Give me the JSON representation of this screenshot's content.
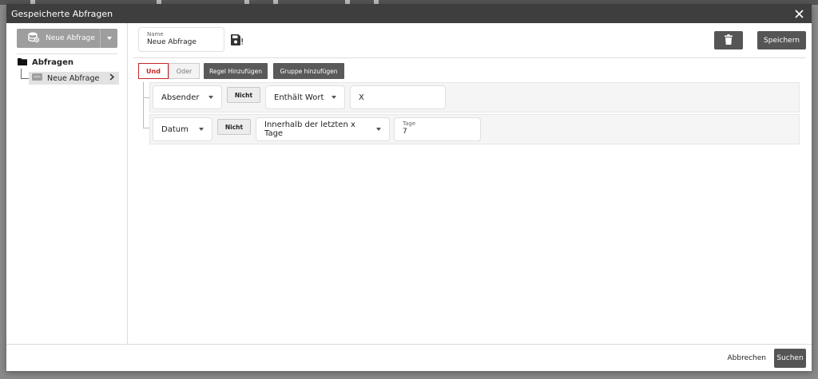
{
  "dialog": {
    "title": "Gespeicherte Abfragen"
  },
  "sidebar": {
    "new_query_label": "Neue Abfrage",
    "tree_root_label": "Abfragen",
    "tree_item_label": "Neue Abfrage"
  },
  "header": {
    "name_label": "Name",
    "name_value": "Neue Abfrage",
    "save_label": "Speichern"
  },
  "toolbar": {
    "and_label": "Und",
    "or_label": "Oder",
    "add_rule_label": "Regel Hinzufügen",
    "add_group_label": "Gruppe hinzufügen"
  },
  "rules": [
    {
      "field": "Absender",
      "not_label": "Nicht",
      "operator": "Enthält Wort",
      "value": "X"
    },
    {
      "field": "Datum",
      "not_label": "Nicht",
      "operator": "Innerhalb der letzten x Tage",
      "value_label": "Tage",
      "value": "7"
    }
  ],
  "footer": {
    "cancel_label": "Abbrechen",
    "search_label": "Suchen"
  },
  "colors": {
    "titlebar": "#3e3e3e",
    "accent_red": "#c62828",
    "dark_button": "#555555"
  }
}
